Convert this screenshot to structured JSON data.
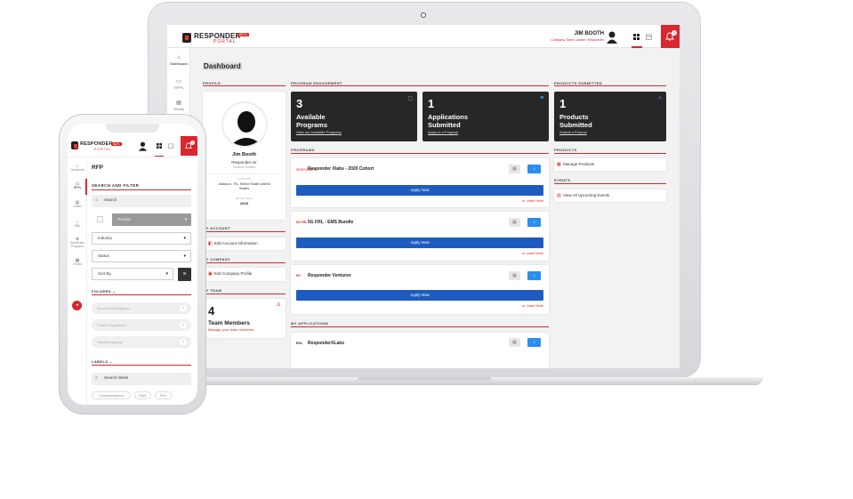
{
  "brand": {
    "name": "RESPONDER",
    "sub": "PORTAL",
    "badge": "BETA"
  },
  "user": {
    "name": "JIM BOOTH",
    "role": "Company Team Leader, Responder"
  },
  "notifications_count": "3",
  "sidebar": [
    {
      "label": "Dashboard",
      "icon": "home-icon"
    },
    {
      "label": "RFPs",
      "icon": "inbox-icon"
    },
    {
      "label": "Grants",
      "icon": "document-icon"
    }
  ],
  "dashboard": {
    "title": "Dashboard",
    "profile_section": "PROFILE",
    "profile": {
      "name": "Jim Booth",
      "company": "Responder Air",
      "position": "Content Position",
      "location_label": "LOCATION",
      "location": "Jackson, TN, Select State United States",
      "member_since_label": "Member Since",
      "member_since": "2020"
    },
    "account_section": "MY ACCOUNT",
    "account_link": "Edit Account Information",
    "company_section": "MY COMPANY",
    "company_link": "Edit Company Profile",
    "team_section": "MY TEAM",
    "team": {
      "count": "4",
      "label": "Team Members",
      "link": "Manage your team members"
    },
    "engagement_section": "PROGRAM ENGAGEMENT",
    "stats": [
      {
        "number": "3",
        "label": "Available Programs",
        "link": "View our Available Programs"
      },
      {
        "number": "1",
        "label": "Applications Submitted",
        "link": "Apply to a Program"
      }
    ],
    "products_submitted_section": "PRODUCTS SUBMITTED",
    "products_stat": {
      "number": "1",
      "label": "Products Submitted",
      "link": "Submit a Product"
    },
    "programs_section": "PROGRAMS",
    "programs": [
      {
        "name": "Responder Xlabs - 2020 Cohort",
        "logo": "RESPONDER",
        "apply": "Apply Now",
        "learn": "or Learn More"
      },
      {
        "name": "5G FRL - EMS Bundle",
        "logo": "5G FRL",
        "apply": "Apply Now",
        "learn": "or Learn More"
      },
      {
        "name": "Responder Ventures",
        "logo": "RV",
        "apply": "Apply Now",
        "learn": "or Learn More"
      }
    ],
    "applications_section": "MY APPLICATIONS",
    "applications": [
      {
        "name": "ResponderXLabs",
        "logo": "RXL"
      }
    ],
    "products_section": "PRODUCTS",
    "products_link": "Manage Products",
    "events_section": "EVENTS",
    "events_link": "View All Upcoming Events"
  },
  "phone": {
    "title": "RFP",
    "search_filter": "SEARCH AND FILTER",
    "search_placeholder": "Search",
    "view_select": "Results",
    "industry": "Industry",
    "status": "Status",
    "sort": "Sort By",
    "sidebar": [
      {
        "label": "Dashboard"
      },
      {
        "label": "RFPs"
      },
      {
        "label": "Grants"
      },
      {
        "label": "SBIr"
      },
      {
        "label": "Accelerator Programs"
      },
      {
        "label": "Events"
      }
    ],
    "folders_section": "FOLDERS",
    "folders": [
      {
        "name": "Government Agency",
        "count": "0"
      },
      {
        "name": "Police Department",
        "count": "0"
      },
      {
        "name": "Security Agency",
        "count": "0"
      }
    ],
    "labels_section": "LABELS",
    "labels_placeholder": "Search labels",
    "chips": [
      "Communications",
      "EMS",
      "Fire"
    ]
  },
  "colors": {
    "accent": "#d8272f",
    "primary": "#1e5bbf",
    "info": "#2b8ef0",
    "dark": "#272727"
  }
}
